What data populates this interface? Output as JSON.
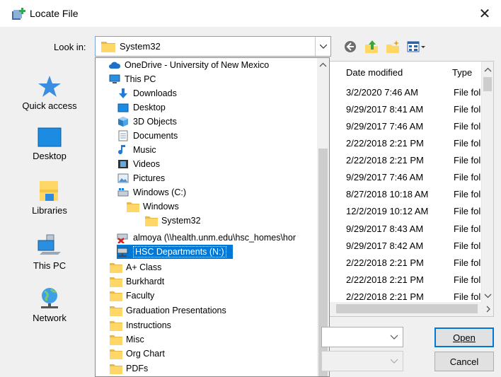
{
  "window": {
    "title": "Locate File",
    "close_glyph": "✕"
  },
  "lookin": {
    "label": "Look in:",
    "value": "System32"
  },
  "toolbar": {
    "icons": [
      "back-icon",
      "up-folder-icon",
      "new-folder-icon",
      "view-menu-icon"
    ]
  },
  "places": [
    {
      "label": "Quick access",
      "icon": "star-icon"
    },
    {
      "label": "Desktop",
      "icon": "desktop-icon"
    },
    {
      "label": "Libraries",
      "icon": "libraries-icon"
    },
    {
      "label": "This PC",
      "icon": "computer-icon"
    },
    {
      "label": "Network",
      "icon": "network-icon"
    }
  ],
  "columns": {
    "date": "Date modified",
    "type": "Type"
  },
  "rows": [
    {
      "date": "3/2/2020 7:46 AM",
      "type": "File fol"
    },
    {
      "date": "9/29/2017 8:41 AM",
      "type": "File fol"
    },
    {
      "date": "9/29/2017 7:46 AM",
      "type": "File fol"
    },
    {
      "date": "2/22/2018 2:21 PM",
      "type": "File fol"
    },
    {
      "date": "2/22/2018 2:21 PM",
      "type": "File fol"
    },
    {
      "date": "9/29/2017 7:46 AM",
      "type": "File fol"
    },
    {
      "date": "8/27/2018 10:18 AM",
      "type": "File fol"
    },
    {
      "date": "12/2/2019 10:12 AM",
      "type": "File fol"
    },
    {
      "date": "9/29/2017 8:43 AM",
      "type": "File fol"
    },
    {
      "date": "9/29/2017 8:42 AM",
      "type": "File fol"
    },
    {
      "date": "2/22/2018 2:21 PM",
      "type": "File fol"
    },
    {
      "date": "2/22/2018 2:21 PM",
      "type": "File fol"
    },
    {
      "date": "2/22/2018 2:21 PM",
      "type": "File fol"
    }
  ],
  "dropdown": [
    {
      "label": "OneDrive - University of New Mexico",
      "icon": "cloud-icon"
    },
    {
      "label": "This PC",
      "icon": "computer-icon"
    },
    {
      "label": "Downloads",
      "icon": "download-icon"
    },
    {
      "label": "Desktop",
      "icon": "desktop-icon"
    },
    {
      "label": "3D Objects",
      "icon": "cube-icon"
    },
    {
      "label": "Documents",
      "icon": "document-icon"
    },
    {
      "label": "Music",
      "icon": "music-icon"
    },
    {
      "label": "Videos",
      "icon": "video-icon"
    },
    {
      "label": "Pictures",
      "icon": "picture-icon"
    },
    {
      "label": "Windows (C:)",
      "icon": "drive-icon"
    },
    {
      "label": "Windows",
      "icon": "folder-icon"
    },
    {
      "label": "System32",
      "icon": "folder-icon"
    },
    {
      "label": "almoya (\\\\health.unm.edu\\hsc_homes\\hor",
      "icon": "disconnected-drive-icon"
    },
    {
      "label": "HSC Departments (N:)",
      "icon": "network-drive-icon",
      "selected": true
    },
    {
      "label": "A+ Class",
      "icon": "folder-icon"
    },
    {
      "label": "Burkhardt",
      "icon": "folder-icon"
    },
    {
      "label": "Faculty",
      "icon": "folder-icon"
    },
    {
      "label": "Graduation Presentations",
      "icon": "folder-icon"
    },
    {
      "label": "Instructions",
      "icon": "folder-icon"
    },
    {
      "label": "Misc",
      "icon": "folder-icon"
    },
    {
      "label": "Org Chart",
      "icon": "folder-icon"
    },
    {
      "label": "PDFs",
      "icon": "folder-icon"
    }
  ],
  "buttons": {
    "open": "Open",
    "cancel": "Cancel"
  },
  "colors": {
    "accent": "#0078d7",
    "folder": "#ffd767"
  }
}
